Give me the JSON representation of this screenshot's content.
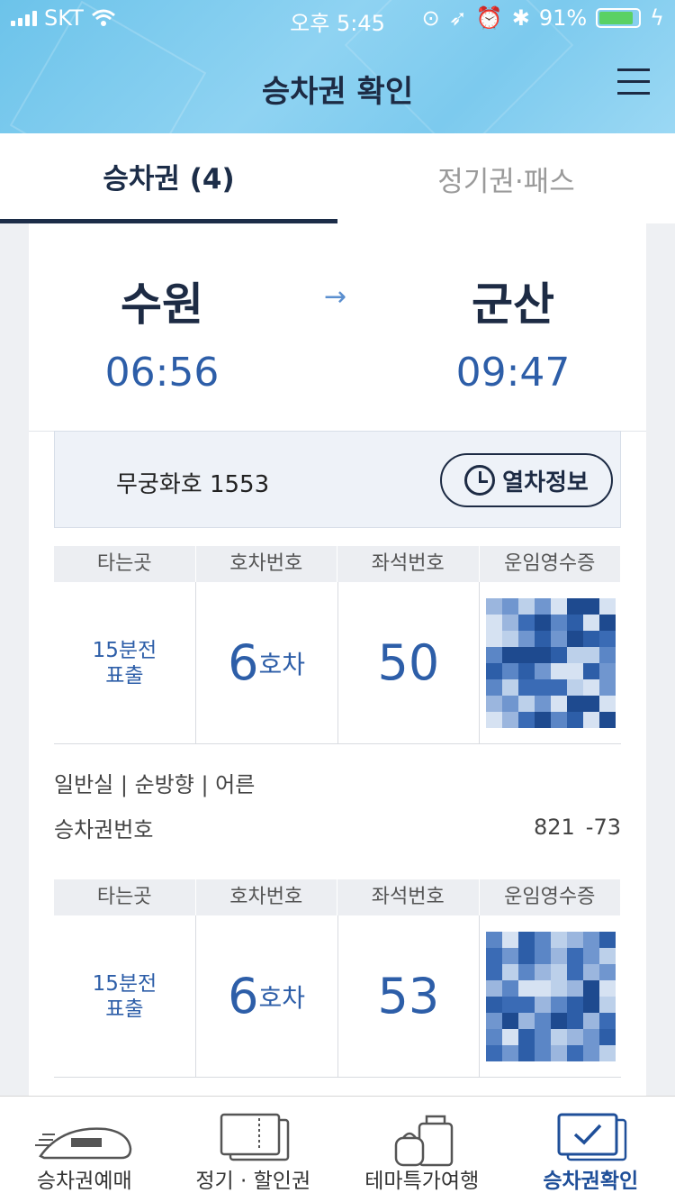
{
  "status": {
    "carrier": "SKT",
    "time": "오후 5:45",
    "battery": "91%"
  },
  "header": {
    "title": "승차권 확인"
  },
  "tabs": [
    {
      "label": "승차권 (4)"
    },
    {
      "label": "정기권·패스"
    }
  ],
  "trip": {
    "from_station": "수원",
    "from_time": "06:56",
    "to_station": "군산",
    "to_time": "09:47"
  },
  "train": {
    "name": "무궁화호 1553",
    "info_button": "열차정보"
  },
  "seat_headers": [
    "타는곳",
    "호차번호",
    "좌석번호",
    "운임영수증"
  ],
  "seats": [
    {
      "board": "15분전\n표출",
      "car": "6",
      "car_unit": "호차",
      "seat": "50"
    },
    {
      "board": "15분전\n표출",
      "car": "6",
      "car_unit": "호차",
      "seat": "53"
    }
  ],
  "ticket_info": {
    "class_line": "일반실 | 순방향 | 어른",
    "ticket_no_label": "승차권번호",
    "ticket_no_value": "821   -73"
  },
  "bottom_nav": [
    {
      "label": "승차권예매"
    },
    {
      "label": "정기 · 할인권"
    },
    {
      "label": "테마특가여행"
    },
    {
      "label": "승차권확인"
    }
  ],
  "colors": {
    "accent": "#2d5ea8",
    "dark": "#1d2b44",
    "header_bg": "#7ccaee"
  }
}
